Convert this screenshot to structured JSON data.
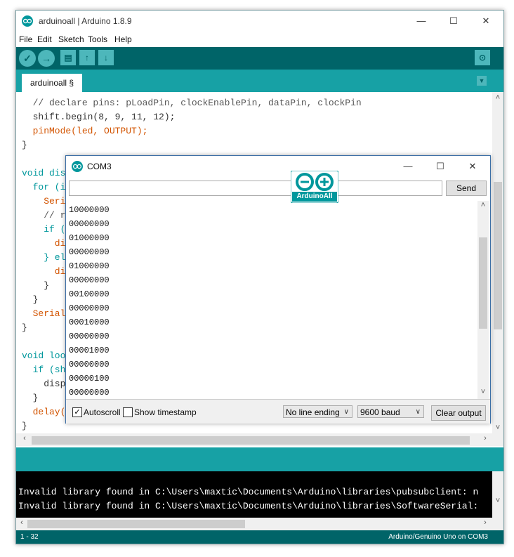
{
  "window": {
    "title": "arduinoall | Arduino 1.8.9",
    "controls": {
      "minimize": "—",
      "maximize": "☐",
      "close": "✕"
    }
  },
  "menu": [
    "File",
    "Edit",
    "Sketch",
    "Tools",
    "Help"
  ],
  "toolbar": {
    "icons": [
      "verify-icon",
      "upload-icon",
      "new-icon",
      "open-icon",
      "save-icon",
      "serial-monitor-icon"
    ]
  },
  "tab": {
    "label": "arduinoall §"
  },
  "editor": {
    "lines": [
      "  // declare pins: pLoadPin, clockEnablePin, dataPin, clockPin",
      "  shift.begin(8, 9, 11, 12);",
      "  pinMode(led, OUTPUT);",
      "}",
      "",
      "void dis",
      "  for (i",
      "    Seri",
      "    // r",
      "    if (",
      "      di",
      "    } el",
      "      di",
      "    }",
      "  }",
      "  Serial",
      "}",
      "",
      "void loo",
      "  if (sh",
      "    disp",
      "  }",
      "  delay(",
      "}"
    ]
  },
  "console": {
    "lines": [
      "Invalid library found in C:\\Users\\maxtic\\Documents\\Arduino\\libraries\\pubsubclient: n",
      "Invalid library found in C:\\Users\\maxtic\\Documents\\Arduino\\libraries\\SoftwareSerial:"
    ]
  },
  "statusbar": {
    "line_info": "1 - 32",
    "board": "Arduino/Genuino Uno on COM3"
  },
  "serial_monitor": {
    "title": "COM3",
    "input_value": "",
    "send_label": "Send",
    "output": [
      "10000000",
      "00000000",
      "01000000",
      "00000000",
      "01000000",
      "00000000",
      "00100000",
      "00000000",
      "00010000",
      "00000000",
      "00001000",
      "00000000",
      "00000100",
      "00000000"
    ],
    "autoscroll": {
      "label": "Autoscroll",
      "checked": true,
      "mark": "✓"
    },
    "timestamp": {
      "label": "Show timestamp",
      "checked": false
    },
    "line_ending": "No line ending",
    "baud": "9600 baud",
    "clear_label": "Clear output"
  },
  "logo": {
    "text": "ArduinoAll"
  },
  "colors": {
    "toolbar": "#006468",
    "tabbar": "#17a1a5",
    "button": "#4db7bb",
    "keyword": "#d35400",
    "type": "#00979c"
  }
}
